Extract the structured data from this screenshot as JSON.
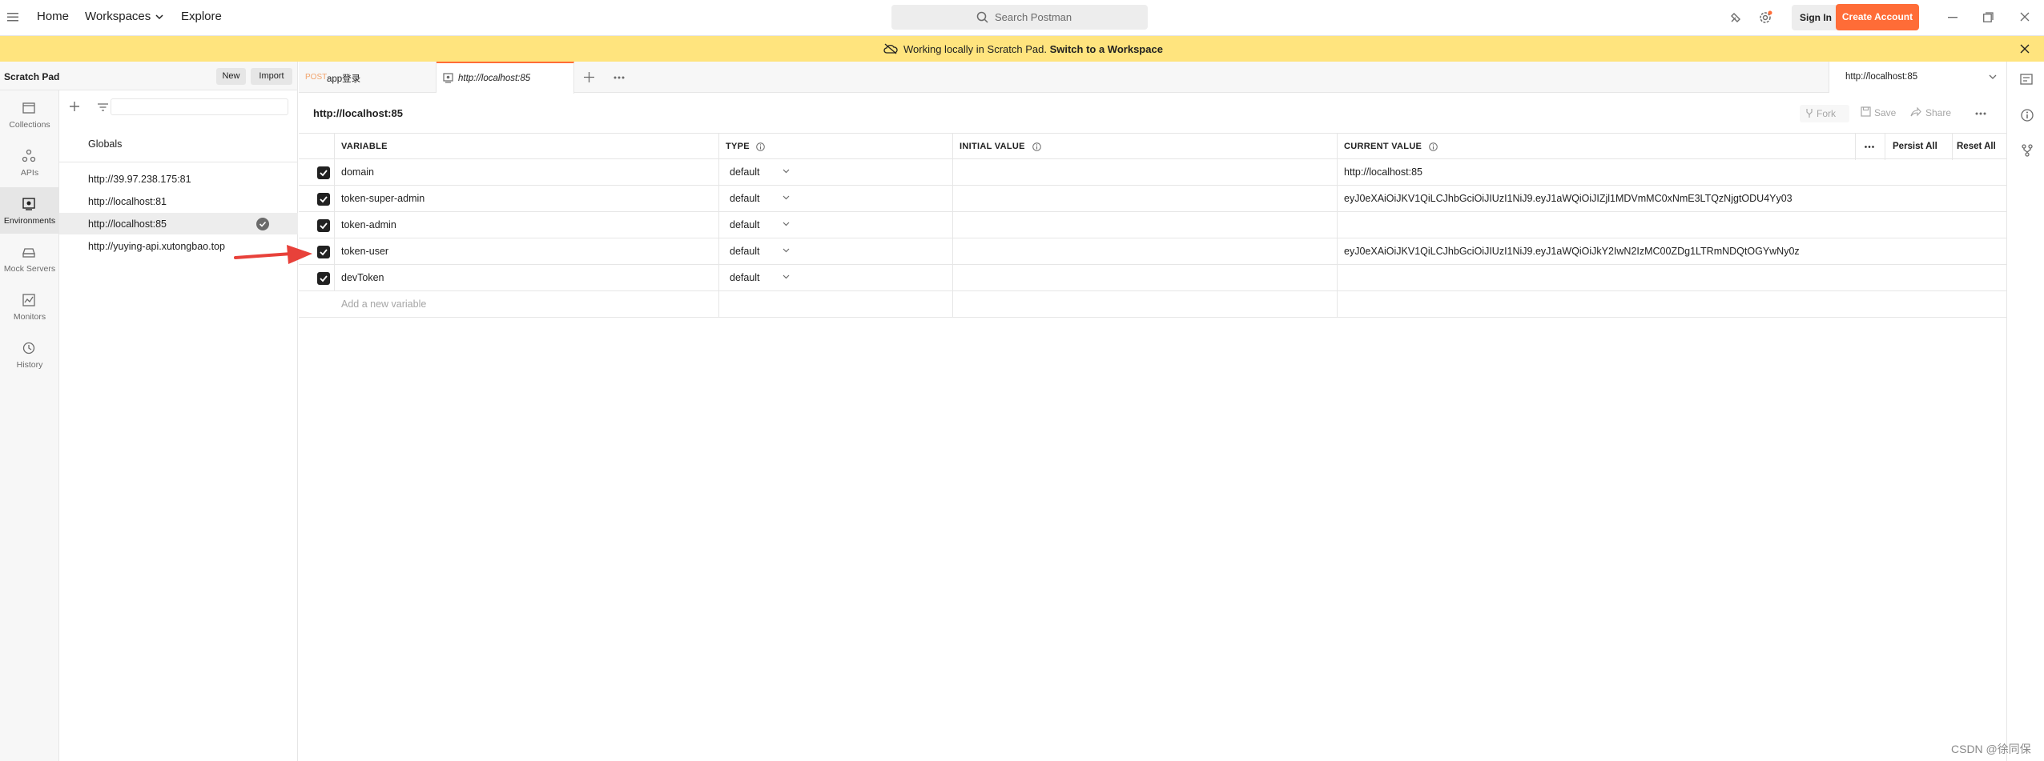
{
  "topbar": {
    "nav": [
      "Home",
      "Workspaces",
      "Explore"
    ],
    "search_placeholder": "Search Postman",
    "sign_in": "Sign In",
    "create_account": "Create Account"
  },
  "banner": {
    "text": "Working locally in Scratch Pad.",
    "link": "Switch to a Workspace"
  },
  "sidebar": {
    "title": "Scratch Pad",
    "new_label": "New",
    "import_label": "Import",
    "rail": [
      {
        "label": "Collections",
        "icon": "collections-icon"
      },
      {
        "label": "APIs",
        "icon": "apis-icon"
      },
      {
        "label": "Environments",
        "icon": "environments-icon",
        "active": true
      },
      {
        "label": "Mock Servers",
        "icon": "mock-servers-icon"
      },
      {
        "label": "Monitors",
        "icon": "monitors-icon"
      },
      {
        "label": "History",
        "icon": "history-icon"
      }
    ],
    "globals": "Globals",
    "environments": [
      "http://39.97.238.175:81",
      "http://localhost:81",
      "http://localhost:85",
      "http://yuying-api.xutongbao.top"
    ]
  },
  "tabs": [
    {
      "method": "POST",
      "label": "app登录"
    },
    {
      "label": "http://localhost:85",
      "active": true
    }
  ],
  "env_selector": "http://localhost:85",
  "environment": {
    "title": "http://localhost:85",
    "actions": [
      "Fork",
      "Save",
      "Share"
    ],
    "columns": [
      "VARIABLE",
      "TYPE",
      "INITIAL VALUE",
      "CURRENT VALUE"
    ],
    "persist_all": "Persist All",
    "reset_all": "Reset All",
    "add_placeholder": "Add a new variable",
    "variables": [
      {
        "name": "domain",
        "type": "default",
        "initial": "",
        "current": "http://localhost:85"
      },
      {
        "name": "token-super-admin",
        "type": "default",
        "initial": "",
        "current": "eyJ0eXAiOiJKV1QiLCJhbGciOiJIUzI1NiJ9.eyJ1aWQiOiJIZjl1MDVmMC0xNmE3LTQzNjgtODU4Yy03"
      },
      {
        "name": "token-admin",
        "type": "default",
        "initial": "",
        "current": ""
      },
      {
        "name": "token-user",
        "type": "default",
        "initial": "",
        "current": "eyJ0eXAiOiJKV1QiLCJhbGciOiJIUzI1NiJ9.eyJ1aWQiOiJkY2IwN2IzMC00ZDg1LTRmNDQtOGYwNy0z"
      },
      {
        "name": "devToken",
        "type": "default",
        "initial": "",
        "current": ""
      }
    ]
  },
  "watermark": "CSDN @徐同保",
  "colors": {
    "accent": "#ff6c37",
    "banner": "#ffe47e",
    "arrow": "#e8413a"
  }
}
